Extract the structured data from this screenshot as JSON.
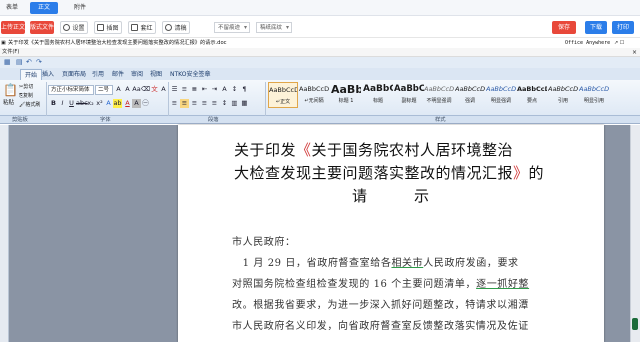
{
  "top_tabs": [
    {
      "label": "表单",
      "active": false
    },
    {
      "label": "正文",
      "active": true
    },
    {
      "label": "附件",
      "active": false
    }
  ],
  "toolbar": {
    "upload_label": "上传正文",
    "template_label": "版式文件",
    "settings_label": "设置",
    "illustration_label": "插图",
    "stamp_label": "套红",
    "clear_label": "清稿",
    "select1_value": "不留痕迹",
    "select2_value": "稿纸底纹",
    "save_label": "保存",
    "download_label": "下载",
    "print_label": "打印"
  },
  "path_bar": {
    "filename": "关于印发《关于国务院农村人居环境整治大检查发现主要问题落实整改的情况汇报》的请示.doc",
    "office_label": "Office Anywhere"
  },
  "menu_bar": {
    "file_menu": "文件(F)"
  },
  "ribbon": {
    "tabs": [
      "开始",
      "插入",
      "页面布局",
      "引用",
      "邮件",
      "审阅",
      "视图",
      "NTKO安全签章"
    ],
    "active_tab": "开始",
    "paste_label": "粘贴",
    "cut_label": "剪切",
    "copy_label": "复制",
    "format_painter_label": "格式刷",
    "font_name": "方正小标宋简体",
    "font_size": "二号",
    "groups": {
      "clipboard": "剪贴板",
      "font": "字体",
      "paragraph": "段落",
      "styles": "样式"
    },
    "styles": [
      {
        "sample": "AaBbCcDd",
        "name": "↵正文"
      },
      {
        "sample": "AaBbCcDd",
        "name": "↵无间隔"
      },
      {
        "sample": "AaBb",
        "name": "标题 1"
      },
      {
        "sample": "AaBbC",
        "name": "标题"
      },
      {
        "sample": "AaBbC",
        "name": "副标题"
      },
      {
        "sample": "AaBbCcDt",
        "name": "不明显强调"
      },
      {
        "sample": "AaBbCcDt",
        "name": "强调"
      },
      {
        "sample": "AaBbCcDt",
        "name": "明显强调"
      },
      {
        "sample": "AaBbCcDd",
        "name": "要点"
      },
      {
        "sample": "AaBbCcDd",
        "name": "引用"
      },
      {
        "sample": "AaBbCcDd",
        "name": "明显引用"
      }
    ]
  },
  "document": {
    "title_line1_a": "关于印发",
    "title_line1_q": "《",
    "title_line1_b": "关于国务院农村人居环境整治",
    "title_line2_a": "大检查发现主要问题落实整改的情况汇报",
    "title_line2_q": "》",
    "title_line2_b": "的",
    "title_line3": "请　　　示",
    "addressee": "市人民政府：",
    "para1_line1_a": "　1 月 29 日，省政府督查室给各",
    "para1_line1_u": "相关市",
    "para1_line1_b": "人民政府发函，要求",
    "para1_line2_a": "对照国务院检查组检查发现的 16 个主要问题清单，",
    "para1_line2_u": "逐一抓好整",
    "para1_line3": "改。根据我省要求，为进一步深入抓好问题整改，特请求以湘潭",
    "para1_line4": "市人民政府名义印发，向省政府督查室反馈整改落实情况及佐证"
  },
  "colors": {
    "accent": "#2b7de9",
    "danger": "#e8483a",
    "ribbon": "#dbe6f3"
  }
}
